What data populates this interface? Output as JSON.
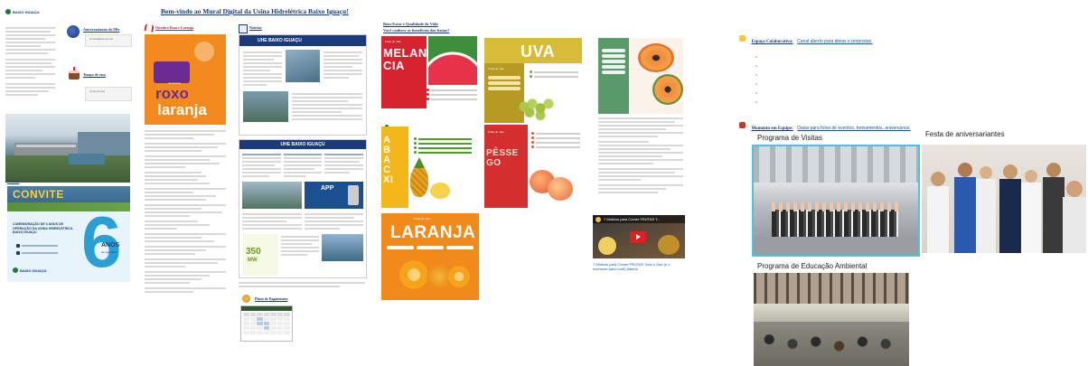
{
  "page": {
    "title": "Bem-vindo ao Mural Digital da Usina Hidrelétrica Baixo Iguaçu!"
  },
  "left_column": {
    "logo_text": "BAIXO IGUAÇU",
    "birthdays_heading": "Aniversariantes do Mês",
    "birthdays_card": "Aniversariantes do mês",
    "company_birthdays_heading": "Tempo de casa",
    "company_birthdays_card": "Tempo de casa",
    "invite_heading": "Convite",
    "invite_banner_title": "CONVITE",
    "invite_text": "COMEMORAÇÃO DE 6 ANOS DE OPERAÇÃO DA USINA HIDRELÉTRICA BAIXO IGUAÇU",
    "invite_number": "6",
    "invite_anos": "ANOS",
    "invite_subtext": "de operação"
  },
  "col2": {
    "heading": "Outubro Rosa e Laranja",
    "poster_small": "campanha",
    "poster_big1": "roxo",
    "poster_big2": "laranja"
  },
  "col3": {
    "heading": "Notícias",
    "news_title1": "UHE BAIXO IGUAÇU",
    "news_title2": "UHE BAIXO IGUAÇU",
    "app_label": "APP",
    "mw_value": "350",
    "mw_unit": "MW",
    "calendar_heading": "Plano de Pagamentos"
  },
  "col4": {
    "heading": "Bem-Estar e Qualidade de Vida",
    "subheading": "Você conhece os benefícios das frutas?",
    "fruits": {
      "melancia": "MELANCIA",
      "uva": "UVA",
      "abacaxi": "ABACXI",
      "pessego": "PÊSSEGO",
      "laranja": "LARANJA",
      "fruta_do_mes": "Fruta do mês"
    },
    "video_title": "7 Motivos para Comer FRUTAS T...",
    "video_caption": "7 Motivos para Comer FRUTAS Todo o Dia! (e o melhores para você) Alberto"
  },
  "right_column": {
    "collab_label": "Espaço Colaborativo:",
    "collab_text": "Canal aberto para ideias e propostas.",
    "moments_label": "Momento em Equipe:",
    "moments_text": "Datas para fotos de eventos, treinamentos, aniversários.",
    "photo1_caption": "Programa de Visitas",
    "photo2_caption": "Festa de aniversariantes",
    "photo3_caption": "Programa de Educação Ambiental"
  },
  "colors": {
    "title_blue": "#1a3a7a",
    "brand_green": "#1f7a3a",
    "orange": "#f08a1a",
    "purple": "#6a2c91",
    "red": "#d6232f",
    "light_blue": "#29a8e0"
  }
}
